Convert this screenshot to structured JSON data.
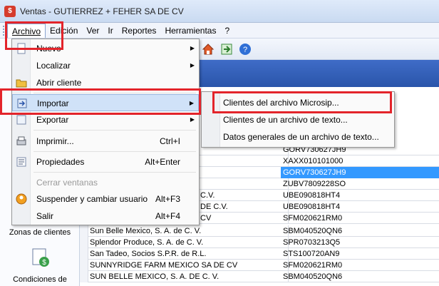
{
  "window": {
    "title": "Ventas - GUTIERREZ + FEHER SA DE CV"
  },
  "menubar": {
    "items": [
      "Archivo",
      "Edición",
      "Ver",
      "Ir",
      "Reportes",
      "Herramientas",
      "?"
    ]
  },
  "archivo_menu": {
    "items": [
      {
        "label": "Nuevo",
        "shortcut": "",
        "submenu": true,
        "icon": "new-document-icon"
      },
      {
        "label": "Localizar",
        "shortcut": "",
        "submenu": true,
        "icon": ""
      },
      {
        "label": "Abrir cliente",
        "shortcut": "",
        "submenu": false,
        "icon": "open-folder-icon"
      },
      {
        "label": "Importar",
        "shortcut": "",
        "submenu": true,
        "icon": "import-icon"
      },
      {
        "label": "Exportar",
        "shortcut": "",
        "submenu": true,
        "icon": "export-icon"
      },
      {
        "label": "Imprimir...",
        "shortcut": "Ctrl+I",
        "submenu": false,
        "icon": "printer-icon"
      },
      {
        "label": "Propiedades",
        "shortcut": "Alt+Enter",
        "submenu": false,
        "icon": "properties-icon"
      },
      {
        "label": "Cerrar ventanas",
        "shortcut": "",
        "submenu": false,
        "icon": ""
      },
      {
        "label": "Suspender y cambiar usuario",
        "shortcut": "Alt+F3",
        "submenu": false,
        "icon": "switch-user-icon"
      },
      {
        "label": "Salir",
        "shortcut": "Alt+F4",
        "submenu": false,
        "icon": ""
      }
    ]
  },
  "importar_submenu": {
    "items": [
      "Clientes del archivo Microsip...",
      "Clientes de un archivo de texto...",
      "Datos generales de un archivo de texto..."
    ]
  },
  "sidebar": {
    "zonas_label": "Zonas de clientes",
    "condiciones_label": "Condiciones de"
  },
  "grid": {
    "rows": [
      {
        "name": "",
        "rfc": "GORV730627JH9"
      },
      {
        "name": "",
        "rfc": "XAXX010101000"
      },
      {
        "name": "",
        "rfc": "GORV730627JH9"
      },
      {
        "name": "",
        "rfc": "ZUBV7809228SO"
      },
      {
        "name": "C.V.",
        "rfc": "UBE090818HT4"
      },
      {
        "name": "DE C.V.",
        "rfc": "UBE090818HT4"
      },
      {
        "name": "CV",
        "rfc": "SFM020621RM0"
      },
      {
        "name": "Sun Belle Mexico, S. A. de C. V.",
        "rfc": "SBM040520QN6"
      },
      {
        "name": "Splendor Produce, S. A. de C. V.",
        "rfc": "SPR0703213Q5"
      },
      {
        "name": "San Tadeo, Socios S.P.R. de R.L.",
        "rfc": "STS100720AN9"
      },
      {
        "name": "SUNNYRIDGE FARM MEXICO SA DE CV",
        "rfc": "SFM020621RM0"
      },
      {
        "name": "SUN BELLE MEXICO, S. A. DE C. V.",
        "rfc": "SBM040520QN6"
      }
    ]
  },
  "colors": {
    "highlight": "#3399ff",
    "annotation": "#e3242b",
    "header": "#2a55aa"
  }
}
